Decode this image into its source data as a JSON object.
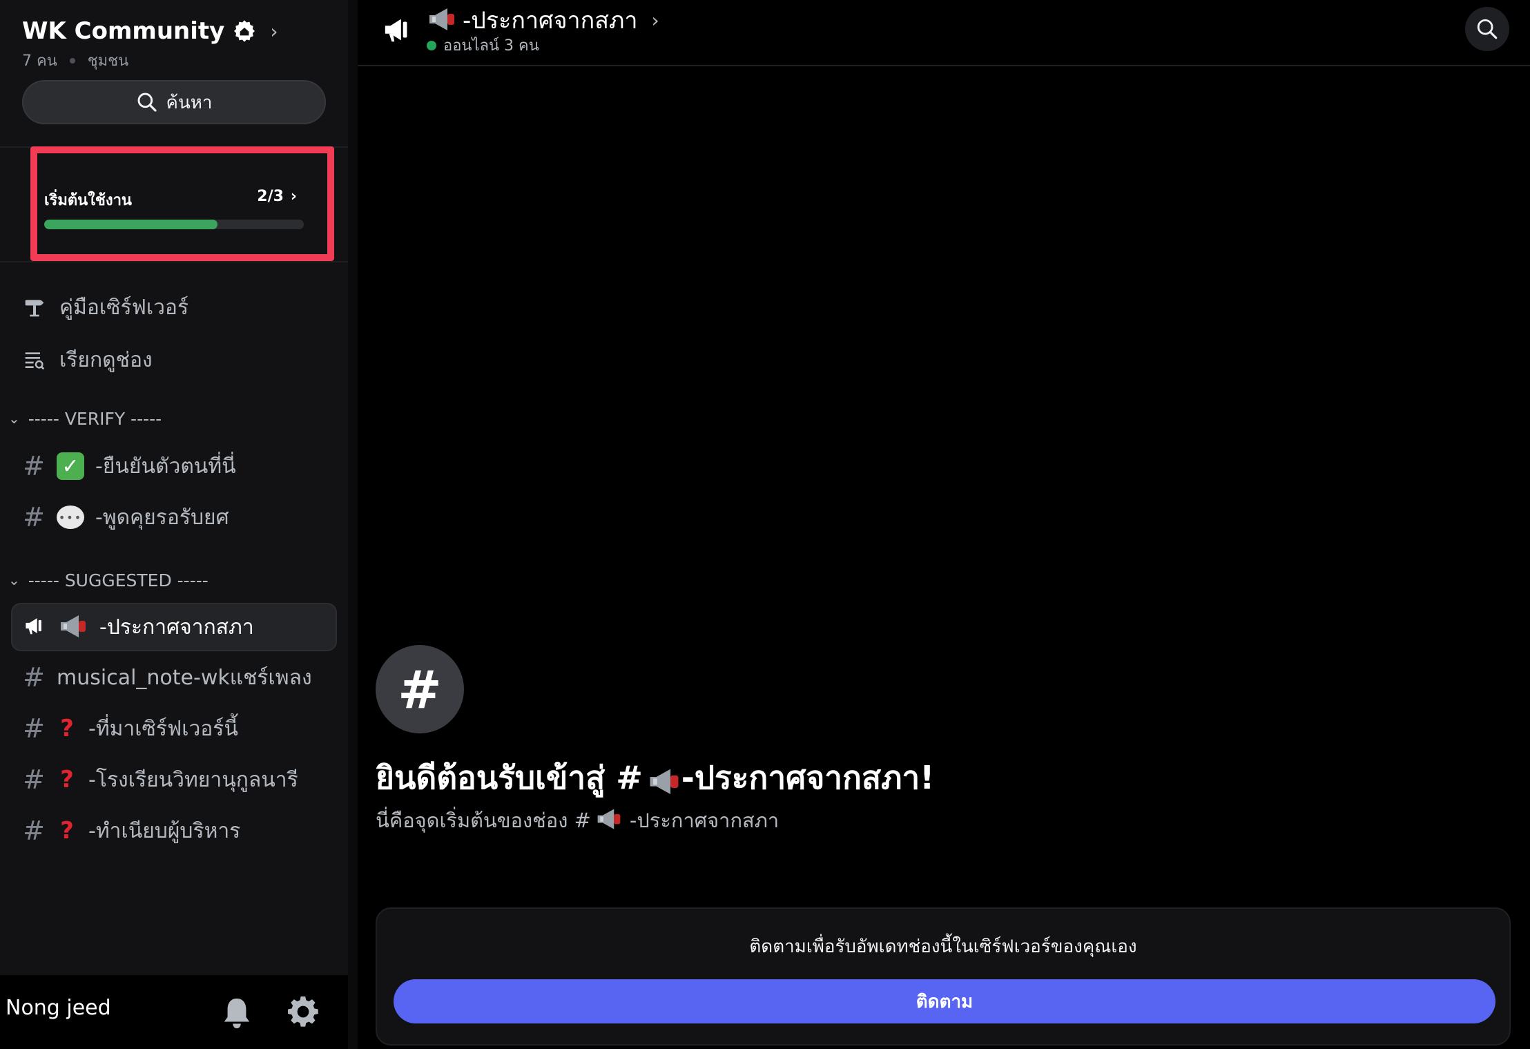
{
  "server": {
    "name": "WK Community",
    "member_count": "7 คน",
    "type_label": "ชุมชน",
    "search_label": "ค้นหา"
  },
  "onboarding": {
    "label": "เริ่มต้นใช้งาน",
    "progress_text": "2/3",
    "progress_fraction": 0.667
  },
  "nav": {
    "server_guide": "คู่มือเซิร์ฟเวอร์",
    "browse_channels": "เรียกดูช่อง"
  },
  "categories": {
    "verify": "----- VERIFY -----",
    "suggested": "----- SUGGESTED -----"
  },
  "channels": {
    "verify_1": "-ยืนยันตัวตนที่นี่",
    "verify_2": "-พูดคุยรอรับยศ",
    "announce": "-ประกาศจากสภา",
    "music": "musical_note-wkแชร์เพลง",
    "q1": "-ที่มาเซิร์ฟเวอร์นี้",
    "q2": "-โรงเรียนวิทยานุกูลนารี",
    "q3": "-ทำเนียบผู้บริหาร"
  },
  "user": {
    "name": "Nong jeed"
  },
  "header": {
    "channel_title": "-ประกาศจากสภา",
    "online_text": "ออนไลน์ 3 คน"
  },
  "welcome": {
    "hash_symbol": "#",
    "title_prefix": "ยินดีต้อนรับเข้าสู่ #",
    "title_suffix": "-ประกาศจากสภา!",
    "sub_prefix": "นี่คือจุดเริ่มต้นของช่อง #",
    "sub_suffix": "-ประกาศจากสภา"
  },
  "follow": {
    "text": "ติดตามเพื่อรับอัพเดทช่องนี้ในเซิร์ฟเวอร์ของคุณเอง",
    "button_label": "ติดตาม"
  },
  "colors": {
    "accent": "#5865f2",
    "progress": "#3ba55d",
    "highlight_border": "#f23c55",
    "online": "#23a55a"
  }
}
